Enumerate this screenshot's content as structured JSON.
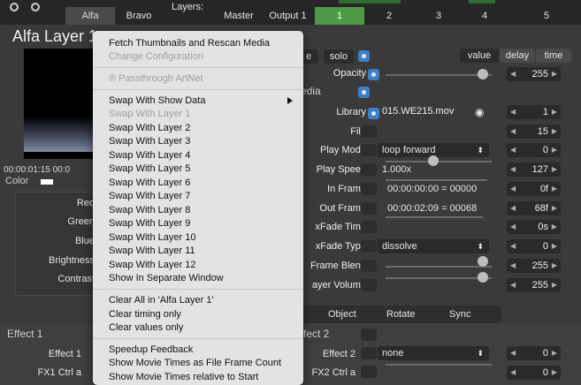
{
  "top_bar": {
    "tabs": [
      "Alfa",
      "Bravo",
      "Layers:",
      "Master",
      "Output 1"
    ],
    "numbers": [
      "1",
      "2",
      "3",
      "4",
      "5"
    ]
  },
  "left_panel": {
    "title": "Alfa Layer 1",
    "timecode": "00:00:01:15  00:0",
    "color_label": "Color",
    "properties": [
      "Red",
      "Green",
      "Blue",
      "Brightness",
      "Contrast"
    ]
  },
  "right_panel": {
    "header_left": [
      "e",
      "solo"
    ],
    "header_right": [
      "value",
      "delay",
      "time"
    ],
    "media_label": "edia",
    "rows": [
      {
        "label": "Opacity",
        "stepper": "255"
      },
      {
        "label": "Library",
        "value": "015.WE215.mov",
        "stepper": "1"
      },
      {
        "label": "File",
        "stepper": "15"
      },
      {
        "label": "Play Mode",
        "value": "loop forward",
        "stepper": "0"
      },
      {
        "label": "Play Speed",
        "value": "1.000x",
        "stepper": "127"
      },
      {
        "label": "In Frame",
        "value": "00:00:00:00 = 00000",
        "stepper": "0f"
      },
      {
        "label": "Out Frame",
        "value": "00:00:02:09 = 00068",
        "stepper": "68f"
      },
      {
        "label": "xFade Time",
        "stepper": "0s"
      },
      {
        "label": "xFade Type",
        "value": "dissolve",
        "stepper": "0"
      },
      {
        "label": "Frame Blend",
        "stepper": "255"
      },
      {
        "label": "ayer Volume",
        "stepper": "255"
      }
    ]
  },
  "bottom_tabs": [
    "Object",
    "Rotate",
    "Sync"
  ],
  "effects": {
    "effect1_title": "Effect 1",
    "effect2_title": "fect 2",
    "effect1_rows": [
      "Effect 1",
      "FX1 Ctrl a"
    ],
    "effect2_rows": [
      "Effect 2",
      "FX2 Ctrl a"
    ],
    "effect2_value": "none",
    "effect2_steppers": [
      "0",
      "0"
    ]
  },
  "menu": {
    "items": [
      {
        "label": "Fetch Thumbnails and Rescan Media",
        "disabled": false
      },
      {
        "label": "Change Configuration",
        "disabled": true
      },
      {
        "label": "® Passthrough ArtNet",
        "disabled": true
      },
      {
        "label": "Swap With Show Data",
        "disabled": false,
        "submenu": true
      },
      {
        "label": "Swap With Layer 1",
        "disabled": true
      },
      {
        "label": "Swap With Layer 2",
        "disabled": false
      },
      {
        "label": "Swap With Layer 3",
        "disabled": false
      },
      {
        "label": "Swap With Layer 4",
        "disabled": false
      },
      {
        "label": "Swap With Layer 5",
        "disabled": false
      },
      {
        "label": "Swap With Layer 6",
        "disabled": false
      },
      {
        "label": "Swap With Layer 7",
        "disabled": false
      },
      {
        "label": "Swap With Layer 8",
        "disabled": false
      },
      {
        "label": "Swap With Layer 9",
        "disabled": false
      },
      {
        "label": "Swap With Layer 10",
        "disabled": false
      },
      {
        "label": "Swap With Layer 11",
        "disabled": false
      },
      {
        "label": "Swap With Layer 12",
        "disabled": false
      },
      {
        "label": "Show In Separate Window",
        "disabled": false
      },
      {
        "label": "Clear All in 'Alfa Layer 1'",
        "disabled": false
      },
      {
        "label": "Clear timing only",
        "disabled": false
      },
      {
        "label": "Clear values only",
        "disabled": false
      },
      {
        "label": "Speedup Feedback",
        "disabled": false
      },
      {
        "label": "Show Movie Times as File Frame Count",
        "disabled": false
      },
      {
        "label": "Show Movie Times relative to Start",
        "disabled": false
      }
    ]
  },
  "colors": {
    "active_number_tab": "#4f9a46",
    "menu_background": "#e3e3e3",
    "blue_toggle": "#3d7fc9"
  }
}
